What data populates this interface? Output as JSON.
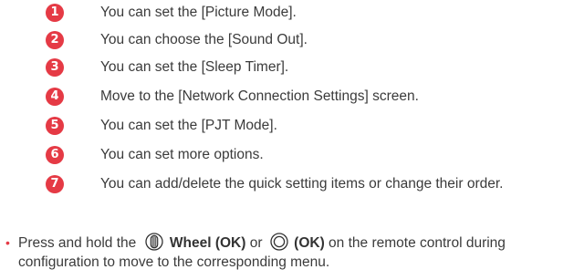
{
  "items": [
    {
      "number": "1",
      "text": "You can set the [Picture Mode]."
    },
    {
      "number": "2",
      "text": "You can choose the [Sound Out]."
    },
    {
      "number": "3",
      "text": "You can set the [Sleep Timer]."
    },
    {
      "number": "4",
      "text": "Move to the [Network Connection Settings] screen."
    },
    {
      "number": "5",
      "text": "You can set the [PJT Mode]."
    },
    {
      "number": "6",
      "text": "You can set more options."
    },
    {
      "number": "7",
      "text": "You can add/delete the quick setting items or change their order."
    }
  ],
  "note": {
    "bullet": "•",
    "part1": "Press and hold the",
    "wheel_label": "Wheel (OK)",
    "or": "or",
    "ok_label": "(OK)",
    "part2": "on the remote control during",
    "line2": "configuration to move to the corresponding menu."
  },
  "colors": {
    "badge": "#e53a45",
    "text": "#3b3b3b"
  },
  "icons": [
    "wheel-icon",
    "ok-button-icon"
  ]
}
